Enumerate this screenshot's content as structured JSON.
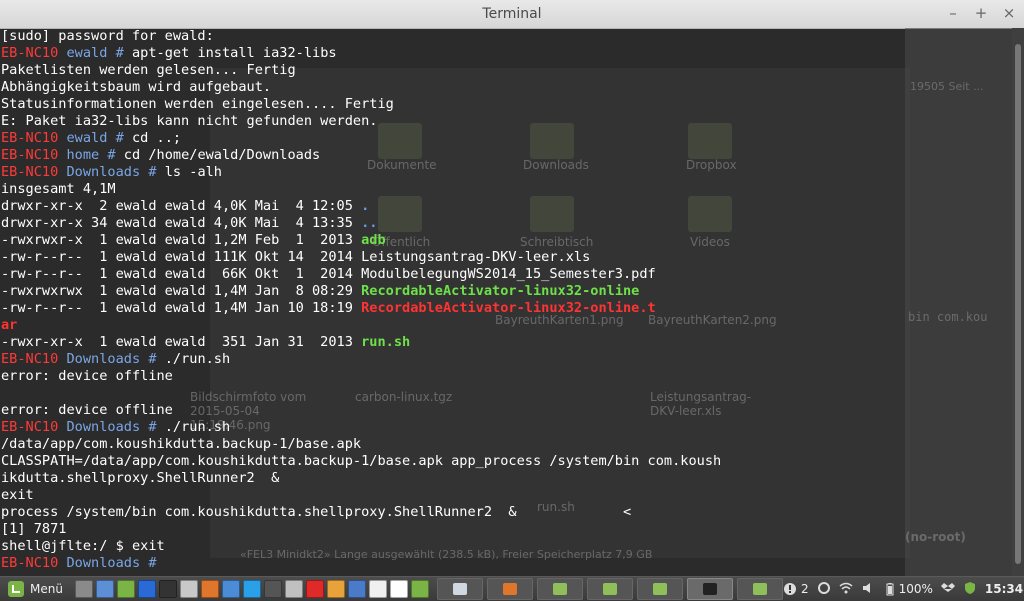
{
  "window": {
    "title": "Terminal",
    "controls": {
      "minimize": "–",
      "maximize": "+",
      "close": "×"
    }
  },
  "background_app": {
    "labels": [
      "Dokumente",
      "Downloads",
      "Dropbox",
      "Öffentlich",
      "Schreibtisch",
      "Videos",
      "BayreuthKarten1.png",
      "BayreuthKarten2.png",
      "Bildschirmfoto vom 2015-05-04 15:19:46.png",
      "carbon-linux.tgz",
      "Leistungsantrag-DKV-leer.xls",
      "run.sh",
      "«FEL3 Minidkt2» Lange ausgewählt (238.5 kB), Freier Speicherplatz 7,9 GB",
      "19505 Seit ...",
      "bin com.kou",
      "(no-root)"
    ]
  },
  "terminal": {
    "lines": [
      [
        {
          "t": "[sudo] password for ewald:",
          "c": ""
        }
      ],
      [
        {
          "t": "EB-NC10",
          "c": "host"
        },
        {
          "t": " ewald # ",
          "c": "dir"
        },
        {
          "t": "apt-get install ia32-libs",
          "c": ""
        }
      ],
      [
        {
          "t": "Paketlisten werden gelesen... Fertig",
          "c": ""
        }
      ],
      [
        {
          "t": "Abhängigkeitsbaum wird aufgebaut.",
          "c": ""
        }
      ],
      [
        {
          "t": "Statusinformationen werden eingelesen.... Fertig",
          "c": ""
        }
      ],
      [
        {
          "t": "E: Paket ia32-libs kann nicht gefunden werden.",
          "c": ""
        }
      ],
      [
        {
          "t": "EB-NC10",
          "c": "host"
        },
        {
          "t": " ewald # ",
          "c": "dir"
        },
        {
          "t": "cd ..;",
          "c": ""
        }
      ],
      [
        {
          "t": "EB-NC10",
          "c": "host"
        },
        {
          "t": " home # ",
          "c": "dir"
        },
        {
          "t": "cd /home/ewald/Downloads",
          "c": ""
        }
      ],
      [
        {
          "t": "EB-NC10",
          "c": "host"
        },
        {
          "t": " Downloads # ",
          "c": "dir"
        },
        {
          "t": "ls -alh",
          "c": ""
        }
      ],
      [
        {
          "t": "insgesamt 4,1M",
          "c": ""
        }
      ],
      [
        {
          "t": "drwxr-xr-x  2 ewald ewald 4,0K Mai  4 12:05 ",
          "c": ""
        },
        {
          "t": ".",
          "c": "blue"
        }
      ],
      [
        {
          "t": "drwxr-xr-x 34 ewald ewald 4,0K Mai  4 13:35 ",
          "c": ""
        },
        {
          "t": "..",
          "c": "blue"
        }
      ],
      [
        {
          "t": "-rwxrwxr-x  1 ewald ewald 1,2M Feb  1  2013 ",
          "c": ""
        },
        {
          "t": "adb",
          "c": "green"
        }
      ],
      [
        {
          "t": "-rw-r--r--  1 ewald ewald 111K Okt 14  2014 Leistungsantrag-DKV-leer.xls",
          "c": ""
        }
      ],
      [
        {
          "t": "-rw-r--r--  1 ewald ewald  66K Okt  1  2014 ModulbelegungWS2014_15_Semester3.pdf",
          "c": ""
        }
      ],
      [
        {
          "t": "-rwxrwxrwx  1 ewald ewald 1,4M Jan  8 08:29 ",
          "c": ""
        },
        {
          "t": "RecordableActivator-linux32-online",
          "c": "green"
        }
      ],
      [
        {
          "t": "-rw-r--r--  1 ewald ewald 1,4M Jan 10 18:19 ",
          "c": ""
        },
        {
          "t": "RecordableActivator-linux32-online.t",
          "c": "red"
        }
      ],
      [
        {
          "t": "ar",
          "c": "red"
        }
      ],
      [
        {
          "t": "-rwxr-xr-x  1 ewald ewald  351 Jan 31  2013 ",
          "c": ""
        },
        {
          "t": "run.sh",
          "c": "green"
        }
      ],
      [
        {
          "t": "EB-NC10",
          "c": "host"
        },
        {
          "t": " Downloads # ",
          "c": "dir"
        },
        {
          "t": "./run.sh",
          "c": ""
        }
      ],
      [
        {
          "t": "error: device offline",
          "c": ""
        }
      ],
      [
        {
          "t": "",
          "c": ""
        }
      ],
      [
        {
          "t": "error: device offline",
          "c": ""
        }
      ],
      [
        {
          "t": "EB-NC10",
          "c": "host"
        },
        {
          "t": " Downloads # ",
          "c": "dir"
        },
        {
          "t": "./run.sh",
          "c": ""
        }
      ],
      [
        {
          "t": "/data/app/com.koushikdutta.backup-1/base.apk",
          "c": ""
        }
      ],
      [
        {
          "t": "CLASSPATH=/data/app/com.koushikdutta.backup-1/base.apk app_process /system/bin com.koush",
          "c": ""
        }
      ],
      [
        {
          "t": "ikdutta.shellproxy.ShellRunner2  &",
          "c": ""
        }
      ],
      [
        {
          "t": "exit",
          "c": ""
        }
      ],
      [
        {
          "t": "process /system/bin com.koushikdutta.shellproxy.ShellRunner2  &             <",
          "c": ""
        }
      ],
      [
        {
          "t": "[1] 7871",
          "c": ""
        }
      ],
      [
        {
          "t": "shell@jflte:/ $ exit",
          "c": ""
        }
      ],
      [
        {
          "t": "EB-NC10",
          "c": "host"
        },
        {
          "t": " Downloads # ",
          "c": "dir"
        }
      ]
    ]
  },
  "taskbar": {
    "menu_label": "Menü",
    "launcher_icons": [
      "desktop-icon",
      "files-icon",
      "green-app-icon",
      "bluetooth-icon",
      "terminal-icon",
      "screenshot-icon",
      "firefox-icon",
      "dropbox-icon",
      "skype-icon",
      "sound-icon",
      "calculator-icon",
      "opera-icon",
      "archive-icon",
      "text-editor-icon",
      "document-icon",
      "font-icon",
      "mint-icon"
    ],
    "tasks": [
      {
        "icon": "window-icon",
        "active": false
      },
      {
        "icon": "firefox-icon",
        "active": false
      },
      {
        "icon": "folder-icon",
        "active": false
      },
      {
        "icon": "folder-icon",
        "active": false
      },
      {
        "icon": "folder-icon",
        "active": false
      },
      {
        "icon": "terminal-icon",
        "active": true
      },
      {
        "icon": "folder-icon",
        "active": false
      }
    ],
    "tray": {
      "notifications_count": "2",
      "battery": "100%",
      "clock": "15:34"
    }
  },
  "colors": {
    "prompt_host": "#ff3a3a",
    "prompt_dir": "#7aa6e6",
    "exec_green": "#6fe04a",
    "archive_red": "#ff3333",
    "dir_blue": "#6a9cf0"
  }
}
